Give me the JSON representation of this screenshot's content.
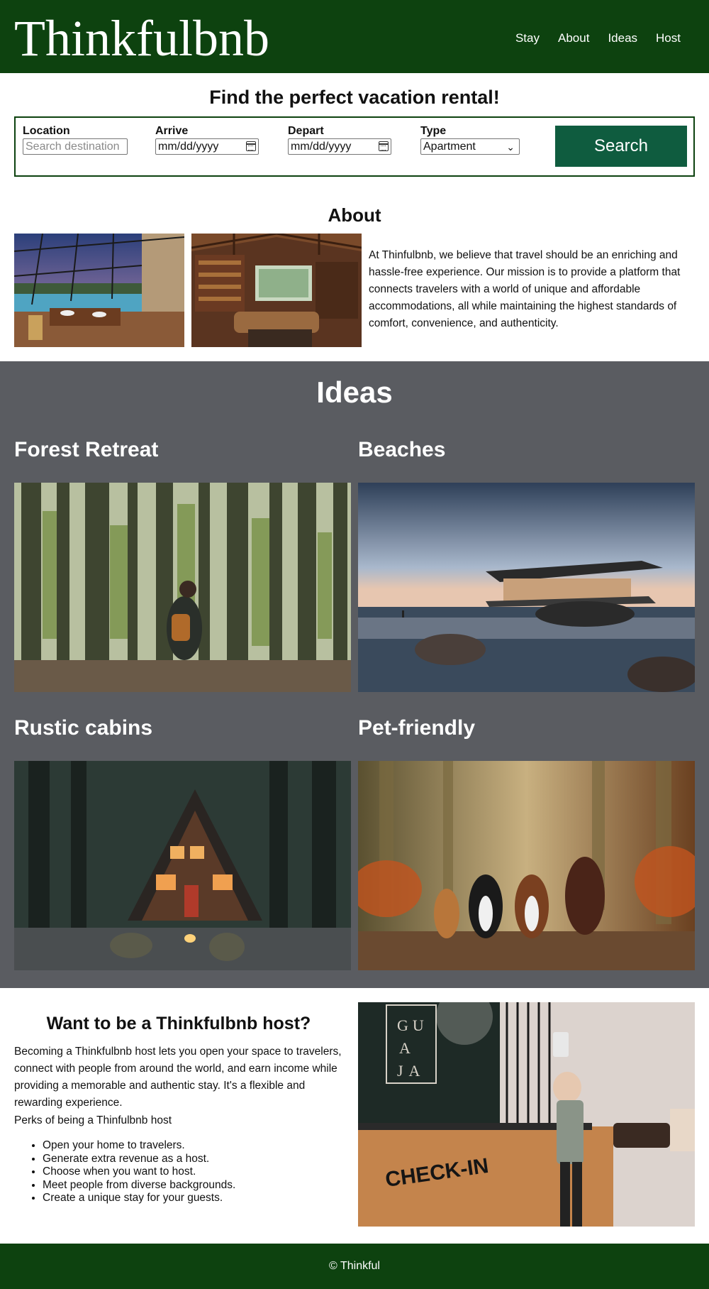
{
  "header": {
    "brand": "Thinkfulbnb",
    "nav": [
      "Stay",
      "About",
      "Ideas",
      "Host"
    ]
  },
  "search": {
    "title": "Find the perfect vacation rental!",
    "location_label": "Location",
    "location_placeholder": "Search destination",
    "arrive_label": "Arrive",
    "arrive_value": "mm/dd/yyyy",
    "depart_label": "Depart",
    "depart_value": "mm/dd/yyyy",
    "type_label": "Type",
    "type_value": "Apartment",
    "button": "Search"
  },
  "about": {
    "title": "About",
    "text": "At Thinfulbnb, we believe that travel should be an enriching and hassle-free experience. Our mission is to provide a platform that connects travelers with a world of unique and affordable accommodations, all while maintaining the highest standards of comfort, convenience, and authenticity."
  },
  "ideas": {
    "title": "Ideas",
    "items": [
      "Forest Retreat",
      "Beaches",
      "Rustic cabins",
      "Pet-friendly"
    ]
  },
  "host": {
    "title": "Want to be a Thinkfulbnb host?",
    "text": "Becoming a Thinkfulbnb host lets you open your space to travelers, connect with people from around the world, and earn income while providing a memorable and authentic stay. It's a flexible and rewarding experience.",
    "perks_title": "Perks of being a Thinfulbnb host",
    "perks": [
      "Open your home to travelers.",
      "Generate extra revenue as a host.",
      "Choose when you want to host.",
      "Meet people from diverse backgrounds.",
      "Create a unique stay for your guests."
    ],
    "sign_letters": "GU\nA\nJ A",
    "counter_text": "CHECK-IN"
  },
  "footer": {
    "text": "© Thinkful"
  },
  "colors": {
    "header_green": "#0d420f",
    "button_green": "#0f5c3f",
    "ideas_gray": "#5a5c61"
  }
}
